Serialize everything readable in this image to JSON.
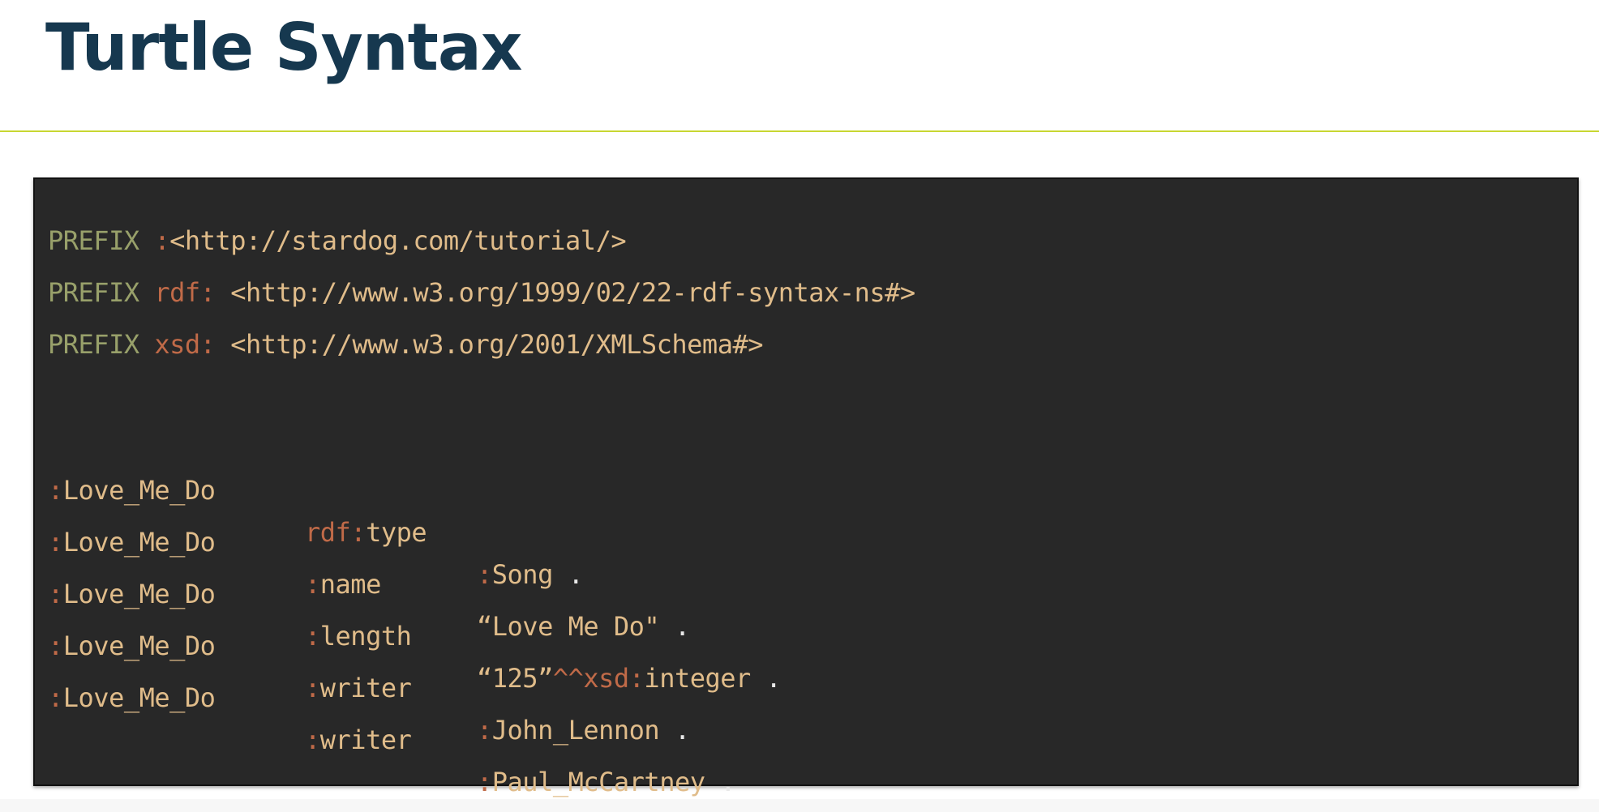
{
  "slide": {
    "title": "Turtle Syntax"
  },
  "prefixes": [
    {
      "keyword": "PREFIX",
      "ns": ":",
      "iri": "<http://stardog.com/tutorial/>"
    },
    {
      "keyword": "PREFIX",
      "ns": "rdf:",
      "iri": "<http://www.w3.org/1999/02/22-rdf-syntax-ns#>"
    },
    {
      "keyword": "PREFIX",
      "ns": "xsd:",
      "iri": "<http://www.w3.org/2001/XMLSchema#>"
    }
  ],
  "triples": [
    {
      "s_ns": ":",
      "s": "Love_Me_Do",
      "p_ns": "rdf:",
      "p": "type",
      "o_ns": ":",
      "o": "Song",
      "end": "."
    },
    {
      "s_ns": ":",
      "s": "Love_Me_Do",
      "p_ns": ":",
      "p": "name",
      "o": "“Love Me Do\"",
      "end": "."
    },
    {
      "s_ns": ":",
      "s": "Love_Me_Do",
      "p_ns": ":",
      "p": "length",
      "o": "“125”",
      "dt_ns": "^^xsd:",
      "dt": "integer",
      "end": "."
    },
    {
      "s_ns": ":",
      "s": "Love_Me_Do",
      "p_ns": ":",
      "p": "writer",
      "o_ns": ":",
      "o": "John_Lennon",
      "end": "."
    },
    {
      "s_ns": ":",
      "s": "Love_Me_Do",
      "p_ns": ":",
      "p": "writer",
      "o_ns": ":",
      "o": "Paul_McCartney",
      "end": "."
    }
  ],
  "colors": {
    "title": "#16384f",
    "rule": "#c8d732",
    "code_background": "#282828",
    "keyword": "#98a06a",
    "namespace": "#c06a48",
    "token": "#e0bc8a",
    "terminator": "#e8e8e8"
  }
}
